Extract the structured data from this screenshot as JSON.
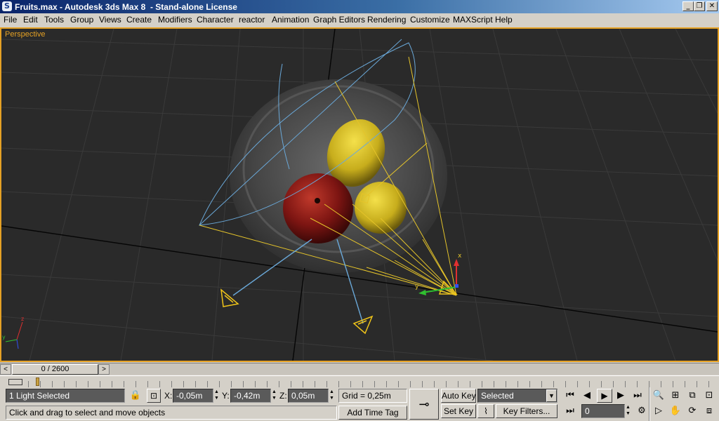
{
  "window": {
    "app_icon": "3ds-max-logo-icon",
    "title": "Fruits.max - Autodesk 3ds Max 8  - Stand-alone License",
    "minimize": "_",
    "maximize": "❐",
    "close": "✕"
  },
  "menu": [
    "File",
    "Edit",
    "Tools",
    "Group",
    "Views",
    "Create",
    "Modifiers",
    "Character",
    "reactor",
    "Animation",
    "Graph Editors",
    "Rendering",
    "Customize",
    "MAXScript",
    "Help"
  ],
  "viewport": {
    "label": "Perspective",
    "accent": "#e5a124",
    "background": "#2a2a2a",
    "gizmo_axes": {
      "x": "x",
      "y": "y",
      "z": "z"
    }
  },
  "timeline": {
    "frame_display": "0 / 2600",
    "prev": "<",
    "next": ">"
  },
  "status": {
    "selection": "1 Light Selected",
    "prompt": "Click and drag to select and move objects",
    "x_label": "X:",
    "x_value": "-0,05m",
    "y_label": "Y:",
    "y_value": "-0,42m",
    "z_label": "Z:",
    "z_value": "0,05m",
    "grid": "Grid = 0,25m",
    "add_time_tag": "Add Time Tag",
    "auto_key": "Auto Key",
    "set_key": "Set Key",
    "selected_dropdown": "Selected",
    "key_filters": "Key Filters...",
    "current_frame": "0"
  }
}
